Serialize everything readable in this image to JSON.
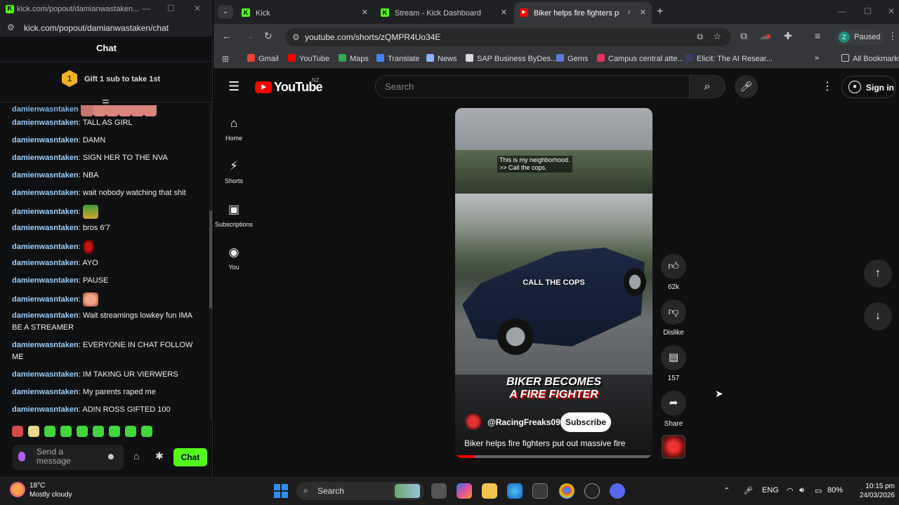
{
  "kick": {
    "tab_title": "kick.com/popout/damianwastaken...",
    "url": "kick.com/popout/damianwastaken/chat",
    "chat_header": "Chat",
    "gift_badge": "1",
    "gift_text": "Gift 1 sub to take 1st",
    "messages": [
      {
        "user": "damienwasntaken",
        "text": "TALL AS GIRL"
      },
      {
        "user": "damienwasntaken",
        "text": "DAMN"
      },
      {
        "user": "damienwasntaken",
        "text": "SIGN HER TO THE NVA"
      },
      {
        "user": "damienwasntaken",
        "text": "NBA"
      },
      {
        "user": "damienwasntaken",
        "text": "wait nobody watching that shit"
      },
      {
        "user": "damienwasntaken",
        "text": ""
      },
      {
        "user": "damienwasntaken",
        "text": "bros 6'7"
      },
      {
        "user": "damienwasntaken",
        "text": ""
      },
      {
        "user": "damienwasntaken",
        "text": "AYO"
      },
      {
        "user": "damienwasntaken",
        "text": "PAUSE"
      },
      {
        "user": "damienwasntaken",
        "text": ""
      },
      {
        "user": "damienwasntaken",
        "text": "Wait streamings lowkey fun IMA BE A STREAMER"
      },
      {
        "user": "damienwasntaken",
        "text": "EVERYONE IN CHAT FOLLOW ME"
      },
      {
        "user": "damienwasntaken",
        "text": "IM TAKING UR VIERWERS"
      },
      {
        "user": "damienwasntaken",
        "text": "My parents raped me"
      },
      {
        "user": "damienwasntaken",
        "text": "ADIN ROSS GIFTED 100"
      }
    ],
    "input_placeholder": "Send a message",
    "send_label": "Chat"
  },
  "chrome": {
    "tabs": [
      {
        "title": "Kick",
        "fav": "K",
        "fav_color": "#53fc18"
      },
      {
        "title": "Stream - Kick Dashboard",
        "fav": "K",
        "fav_color": "#53fc18"
      },
      {
        "title": "Biker helps fire fighters put",
        "fav": "▶",
        "fav_color": "#ff0000"
      }
    ],
    "url": "youtube.com/shorts/zQMPR4Uo34E",
    "profile_initial": "Z",
    "profile_status": "Paused",
    "bookmarks": [
      "Gmail",
      "YouTube",
      "Maps",
      "Translate",
      "News",
      "SAP Business ByDes...",
      "Gems",
      "Campus central atte...",
      "Elicit: The AI Resear...",
      "All Bookmarks"
    ]
  },
  "youtube": {
    "logo_text": "YouTube",
    "country_code": "NZ",
    "search_placeholder": "Search",
    "sign_in": "Sign in",
    "nav": [
      "Home",
      "Shorts",
      "Subscriptions",
      "You"
    ],
    "short": {
      "caption_top": "This is my neighborhood.\n>> Call the cops.",
      "caption_mid": "CALL THE COPS",
      "overlay_line1": "BIKER BECOMES",
      "overlay_line2": "A FIRE FIGHTER",
      "channel": "@RacingFreaks09",
      "subscribe": "Subscribe",
      "title": "Biker helps fire fighters put out massive fire",
      "progress": 0.1
    },
    "actions": {
      "likes": "62k",
      "dislike": "Dislike",
      "comments": "157",
      "share": "Share"
    }
  },
  "taskbar": {
    "temp": "18°C",
    "weather": "Mostly cloudy",
    "search": "Search",
    "lang": "ENG",
    "battery": "80%",
    "time": "10:15 pm",
    "date": "24/03/2026"
  }
}
